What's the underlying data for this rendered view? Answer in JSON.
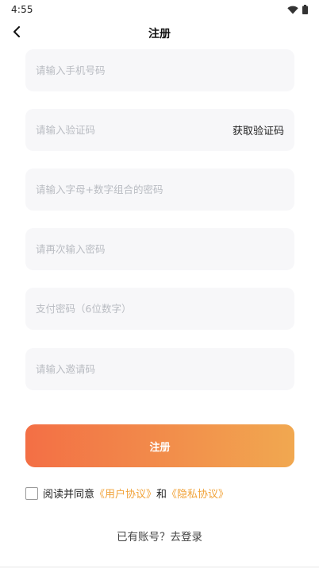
{
  "status_bar": {
    "time": "4:55"
  },
  "nav": {
    "title": "注册"
  },
  "form": {
    "phone_placeholder": "请输入手机号码",
    "code_placeholder": "请输入验证码",
    "get_code_label": "获取验证码",
    "password_placeholder": "请输入字母+数字组合的密码",
    "confirm_password_placeholder": "请再次输入密码",
    "pay_password_placeholder": "支付密码（6位数字）",
    "invite_placeholder": "请输入邀请码"
  },
  "register_button": {
    "label": "注册"
  },
  "agreement": {
    "prefix": "阅读并同意",
    "user_agreement": "《用户协议》",
    "and": "和",
    "privacy_agreement": "《隐私协议》",
    "checked": false
  },
  "login": {
    "text": "已有账号？去登录"
  },
  "colors": {
    "accent_start": "#f36f45",
    "accent_end": "#f1a850",
    "link": "#f1a33a",
    "field_bg": "#f7f7f9"
  }
}
